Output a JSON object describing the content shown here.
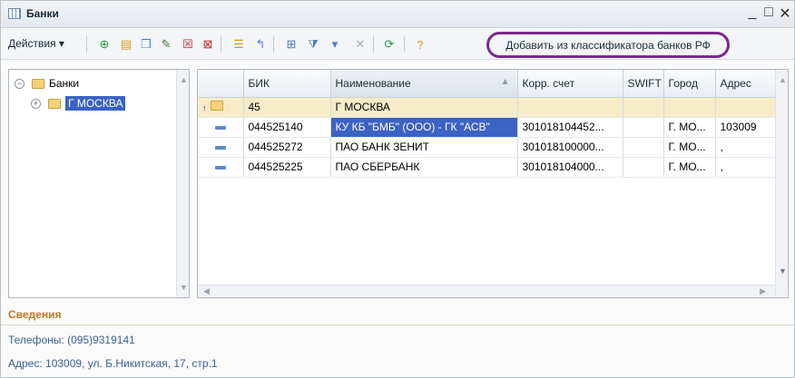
{
  "window": {
    "title": "Банки"
  },
  "toolbar": {
    "actions_label": "Действия ▾",
    "add_from_classifier_label": "Добавить из классификатора банков РФ"
  },
  "tree": {
    "root_label": "Банки",
    "child_label": "Г МОСКВА"
  },
  "grid": {
    "columns": [
      "БИК",
      "Наименование",
      "Корр. счет",
      "SWIFT",
      "Город",
      "Адрес"
    ],
    "group_row": {
      "code": "45",
      "name": "Г МОСКВА"
    },
    "rows": [
      {
        "bik": "044525140",
        "name": "КУ КБ \"БМБ\" (ООО) - ГК \"АСВ\"",
        "corr": "301018104452...",
        "swift": "",
        "city": "Г. МО...",
        "address": "103009"
      },
      {
        "bik": "044525272",
        "name": "ПАО БАНК ЗЕНИТ",
        "corr": "301018100000...",
        "swift": "",
        "city": "Г. МО...",
        "address": ","
      },
      {
        "bik": "044525225",
        "name": "ПАО СБЕРБАНК",
        "corr": "301018104000...",
        "swift": "",
        "city": "Г. МО...",
        "address": ","
      }
    ]
  },
  "details": {
    "header": "Сведения",
    "phones": "Телефоны: (095)9319141",
    "address": "Адрес: 103009, ул. Б.Никитская, 17, стр.1"
  },
  "colors": {
    "accent": "#3b63c4",
    "highlight_ring": "#7b2a8a",
    "details_header": "#c8761e",
    "group_row": "#f6ecc8"
  }
}
